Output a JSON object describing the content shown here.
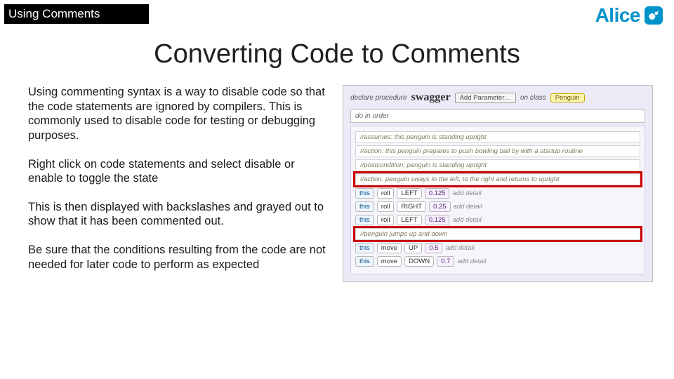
{
  "chrome": {
    "breadcrumb": "Using Comments",
    "brand": "Alice"
  },
  "title": "Converting Code to Comments",
  "body": {
    "p1": "Using commenting syntax is a way to disable code so that the code statements are ignored by compilers.  This is commonly used to disable code for testing or debugging purposes.",
    "p2": "Right click on code statements and select disable or enable to toggle the state",
    "p3": "This is then displayed with backslashes and grayed out to show that it has been commented out.",
    "p4": "Be sure that the conditions resulting from the code are not needed for later code to perform as expected"
  },
  "panel": {
    "declare": "declare procedure",
    "proc_name": "swagger",
    "add_param": "Add Parameter…",
    "on_class": "on class",
    "class_name": "Penguin",
    "do_in_order": "do in order",
    "comments": {
      "assumes": "//assumes: this penguin is standing upright",
      "action1": "//action: this penguin prepares to push bowling ball by with a startup routine",
      "postcond": "//postcondition: penguin is standing upright",
      "action2": "//action: penguin sways to the left, to the right and returns to upright",
      "jump": "//penguin jumps up and down"
    },
    "rows": [
      {
        "kw": "this",
        "act": "roll",
        "dir": "LEFT",
        "val": "0.125",
        "tail": "add detail"
      },
      {
        "kw": "this",
        "act": "roll",
        "dir": "RIGHT",
        "val": "0.25",
        "tail": "add detail"
      },
      {
        "kw": "this",
        "act": "roll",
        "dir": "LEFT",
        "val": "0.125",
        "tail": "add detail"
      },
      {
        "kw": "this",
        "act": "move",
        "dir": "UP",
        "val": "0.5",
        "tail": "add detail"
      },
      {
        "kw": "this",
        "act": "move",
        "dir": "DOWN",
        "val": "0.7",
        "tail": "add detail"
      }
    ]
  }
}
